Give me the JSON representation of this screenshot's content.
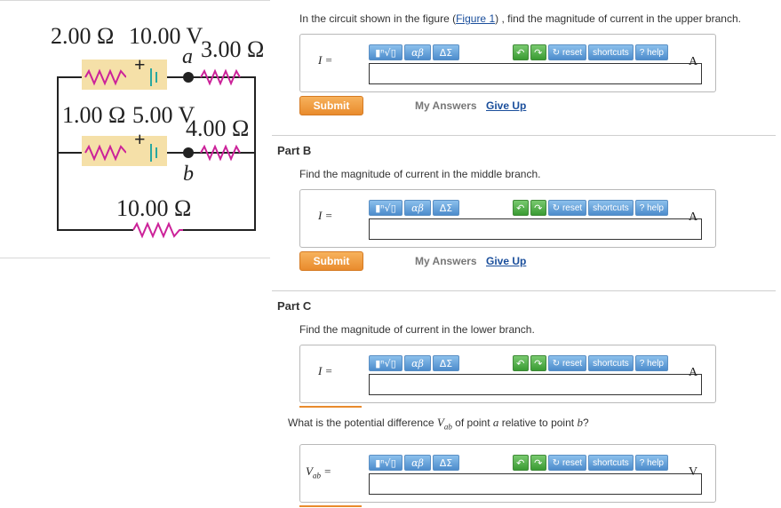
{
  "figure": {
    "top_resistor_label": "2.00 Ω",
    "top_emf_label": "10.00 V",
    "node_a": "a",
    "top_right_resistor_label": "3.00 Ω",
    "mid_resistor_label": "1.00 Ω",
    "mid_emf_label": "5.00 V",
    "mid_right_resistor_label": "4.00 Ω",
    "node_b": "b",
    "bottom_resistor_label": "10.00 Ω",
    "plus_sign": "+",
    "colors": {
      "resistor": "#cc2299",
      "battery_box": "#f5e0a8",
      "wire": "#222222",
      "battery_plate": "#2aa8a0"
    }
  },
  "part_a": {
    "question_prefix": "In the circuit shown in the figure (",
    "figure_link": "Figure 1",
    "question_suffix": ") , find the magnitude of current in the upper branch.",
    "var": "I =",
    "unit": "A",
    "submit": "Submit",
    "my_answers": "My Answers",
    "give_up": "Give Up"
  },
  "part_b": {
    "title": "Part B",
    "question": "Find the magnitude of current in the middle branch.",
    "var": "I =",
    "unit": "A",
    "submit": "Submit",
    "my_answers": "My Answers",
    "give_up": "Give Up"
  },
  "part_c": {
    "title": "Part C",
    "question": "Find the magnitude of current in the lower branch.",
    "var": "I =",
    "unit": "A"
  },
  "part_d": {
    "question_prefix": "What is the potential difference ",
    "vab": "Vab",
    "question_mid": " of point ",
    "point_a": "a",
    "question_mid2": " relative to point ",
    "point_b": "b",
    "question_suffix": "?",
    "var": "Vab =",
    "unit": "V"
  },
  "toolbar": {
    "templates": "▮ⁿ√▯",
    "greek": "αβ",
    "symbols": "ΔΣ",
    "undo": "↶",
    "redo": "↷",
    "reset": "↻ reset",
    "shortcuts": "shortcuts",
    "help": "? help"
  }
}
